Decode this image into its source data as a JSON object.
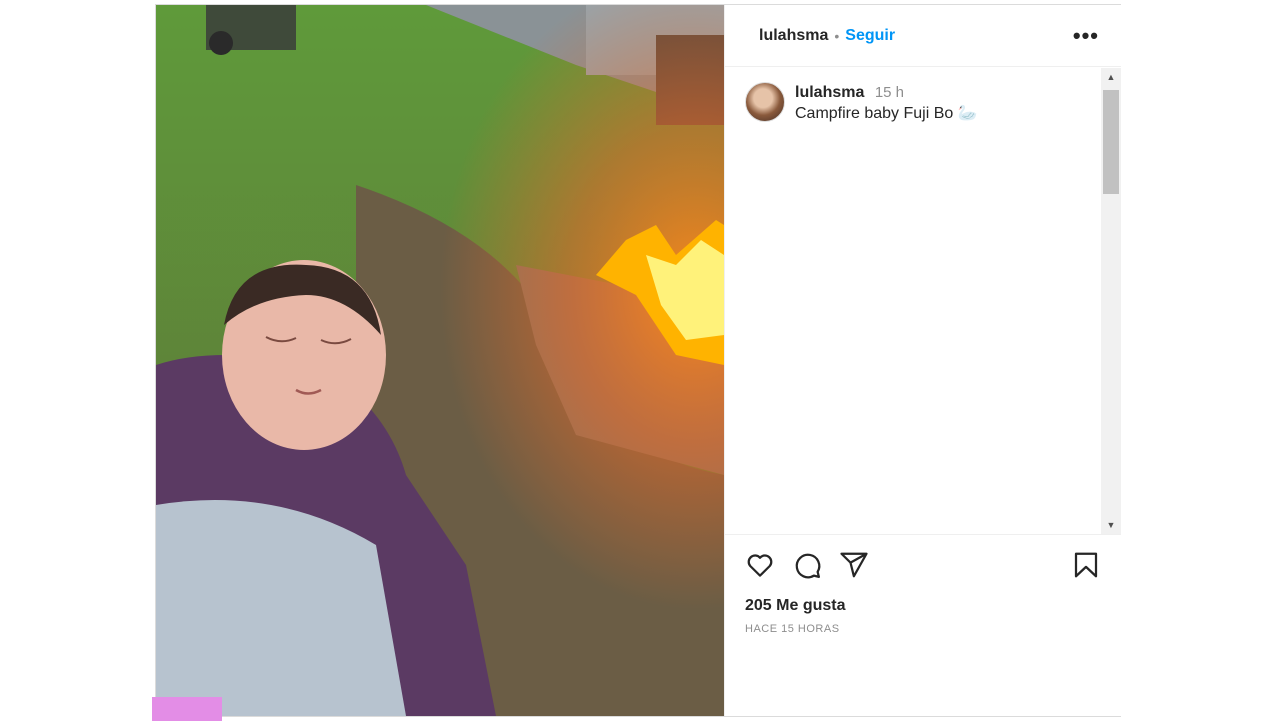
{
  "post": {
    "username": "lulahsma",
    "follow_label": "Seguir",
    "more_label": "•••",
    "caption_user": "lulahsma",
    "caption_time": "15 h",
    "caption_text": "Campfire baby Fuji Bo 🦢",
    "likes": "205 Me gusta",
    "posted_ago": "HACE 15 HORAS"
  },
  "scrollbar": {
    "up_arrow": "▲",
    "down_arrow": "▼"
  },
  "colors": {
    "follow_blue": "#0095f6",
    "text": "#262626",
    "muted": "#8e8e8e"
  }
}
